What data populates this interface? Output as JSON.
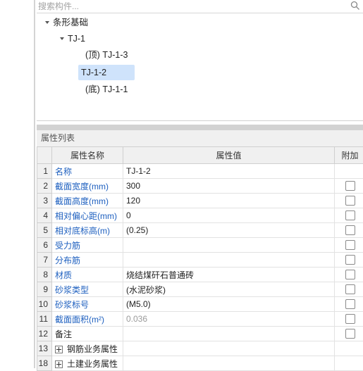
{
  "search": {
    "placeholder": "搜索构件..."
  },
  "tree": {
    "root": "条形基础",
    "child": "TJ-1",
    "leaves": [
      {
        "prefix": "(顶)",
        "label": "TJ-1-3"
      },
      {
        "prefix": "",
        "label": "TJ-1-2",
        "selected": true
      },
      {
        "prefix": "(底)",
        "label": "TJ-1-1"
      }
    ]
  },
  "panel": {
    "title": "属性列表",
    "columns": {
      "name": "属性名称",
      "value": "属性值",
      "extra": "附加"
    },
    "rows": [
      {
        "num": "1",
        "name": "名称",
        "value": "TJ-1-2",
        "check": false
      },
      {
        "num": "2",
        "name": "截面宽度(mm)",
        "value": "300",
        "check": true
      },
      {
        "num": "3",
        "name": "截面高度(mm)",
        "value": "120",
        "check": true
      },
      {
        "num": "4",
        "name": "相对偏心距(mm)",
        "value": "0",
        "check": true
      },
      {
        "num": "5",
        "name": "相对底标高(m)",
        "value": "(0.25)",
        "check": true
      },
      {
        "num": "6",
        "name": "受力筋",
        "value": "",
        "check": true
      },
      {
        "num": "7",
        "name": "分布筋",
        "value": "",
        "check": true
      },
      {
        "num": "8",
        "name": "材质",
        "value": "烧结煤矸石普通砖",
        "check": true
      },
      {
        "num": "9",
        "name": "砂浆类型",
        "value": "(水泥砂浆)",
        "check": true
      },
      {
        "num": "10",
        "name": "砂浆标号",
        "value": "(M5.0)",
        "check": true
      },
      {
        "num": "11",
        "name": "截面面积(m²)",
        "value": "0.036",
        "check": true
      },
      {
        "num": "12",
        "name": "备注",
        "value": "",
        "check": true
      },
      {
        "num": "13",
        "name": "钢筋业务属性",
        "value": "",
        "check": false
      },
      {
        "num": "18",
        "name": "土建业务属性",
        "value": "",
        "check": false
      }
    ]
  },
  "colors": {
    "link": "#1d5fbf",
    "selection": "#cfe3fb",
    "header_bg": "#f0f0f0"
  }
}
